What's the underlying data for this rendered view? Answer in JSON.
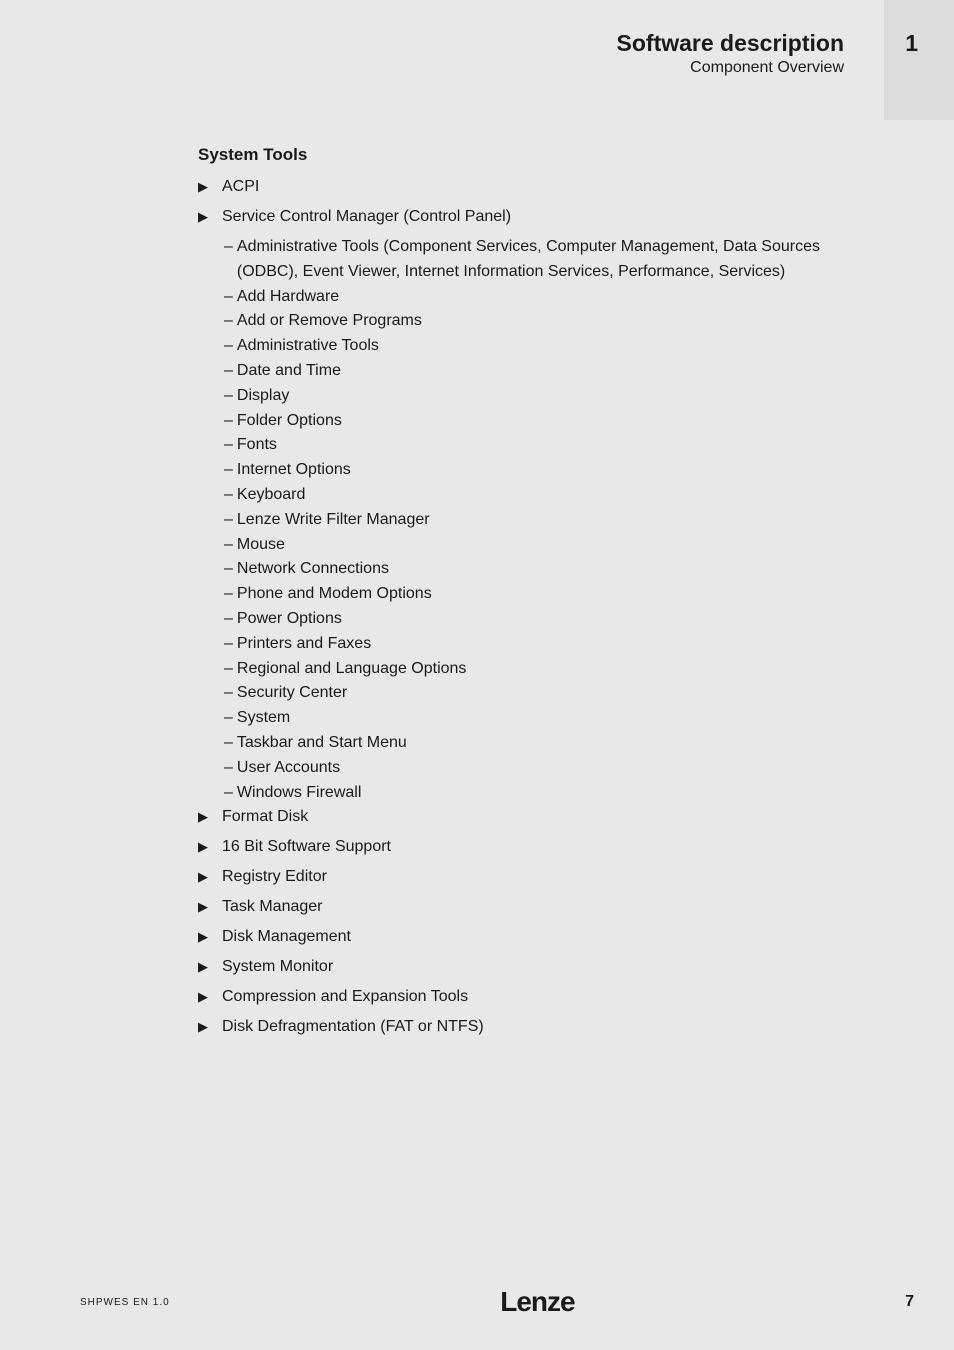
{
  "header": {
    "title": "Software description",
    "subtitle": "Component Overview",
    "chapter": "1"
  },
  "section": {
    "title": "System Tools",
    "bullets": [
      {
        "text": "ACPI",
        "subs": []
      },
      {
        "text": "Service Control Manager (Control Panel)",
        "subs": [
          "Administrative Tools (Component Services, Computer Management, Data Sources (ODBC), Event Viewer, Internet Information Services, Performance, Services)",
          "Add Hardware",
          "Add or Remove Programs",
          "Administrative Tools",
          "Date and Time",
          "Display",
          "Folder Options",
          "Fonts",
          "Internet Options",
          "Keyboard",
          "Lenze Write Filter Manager",
          "Mouse",
          "Network Connections",
          "Phone and Modem Options",
          "Power Options",
          "Printers and Faxes",
          "Regional and Language Options",
          "Security Center",
          "System",
          "Taskbar and Start Menu",
          "User Accounts",
          "Windows Firewall"
        ]
      },
      {
        "text": "Format Disk",
        "subs": []
      },
      {
        "text": "16 Bit Software Support",
        "subs": []
      },
      {
        "text": "Registry Editor",
        "subs": []
      },
      {
        "text": "Task Manager",
        "subs": []
      },
      {
        "text": "Disk Management",
        "subs": []
      },
      {
        "text": "System Monitor",
        "subs": []
      },
      {
        "text": "Compression and Expansion Tools",
        "subs": []
      },
      {
        "text": "Disk Defragmentation (FAT or NTFS)",
        "subs": []
      }
    ]
  },
  "footer": {
    "left": "SHPWES  EN  1.0",
    "logo": "Lenze",
    "page": "7"
  }
}
